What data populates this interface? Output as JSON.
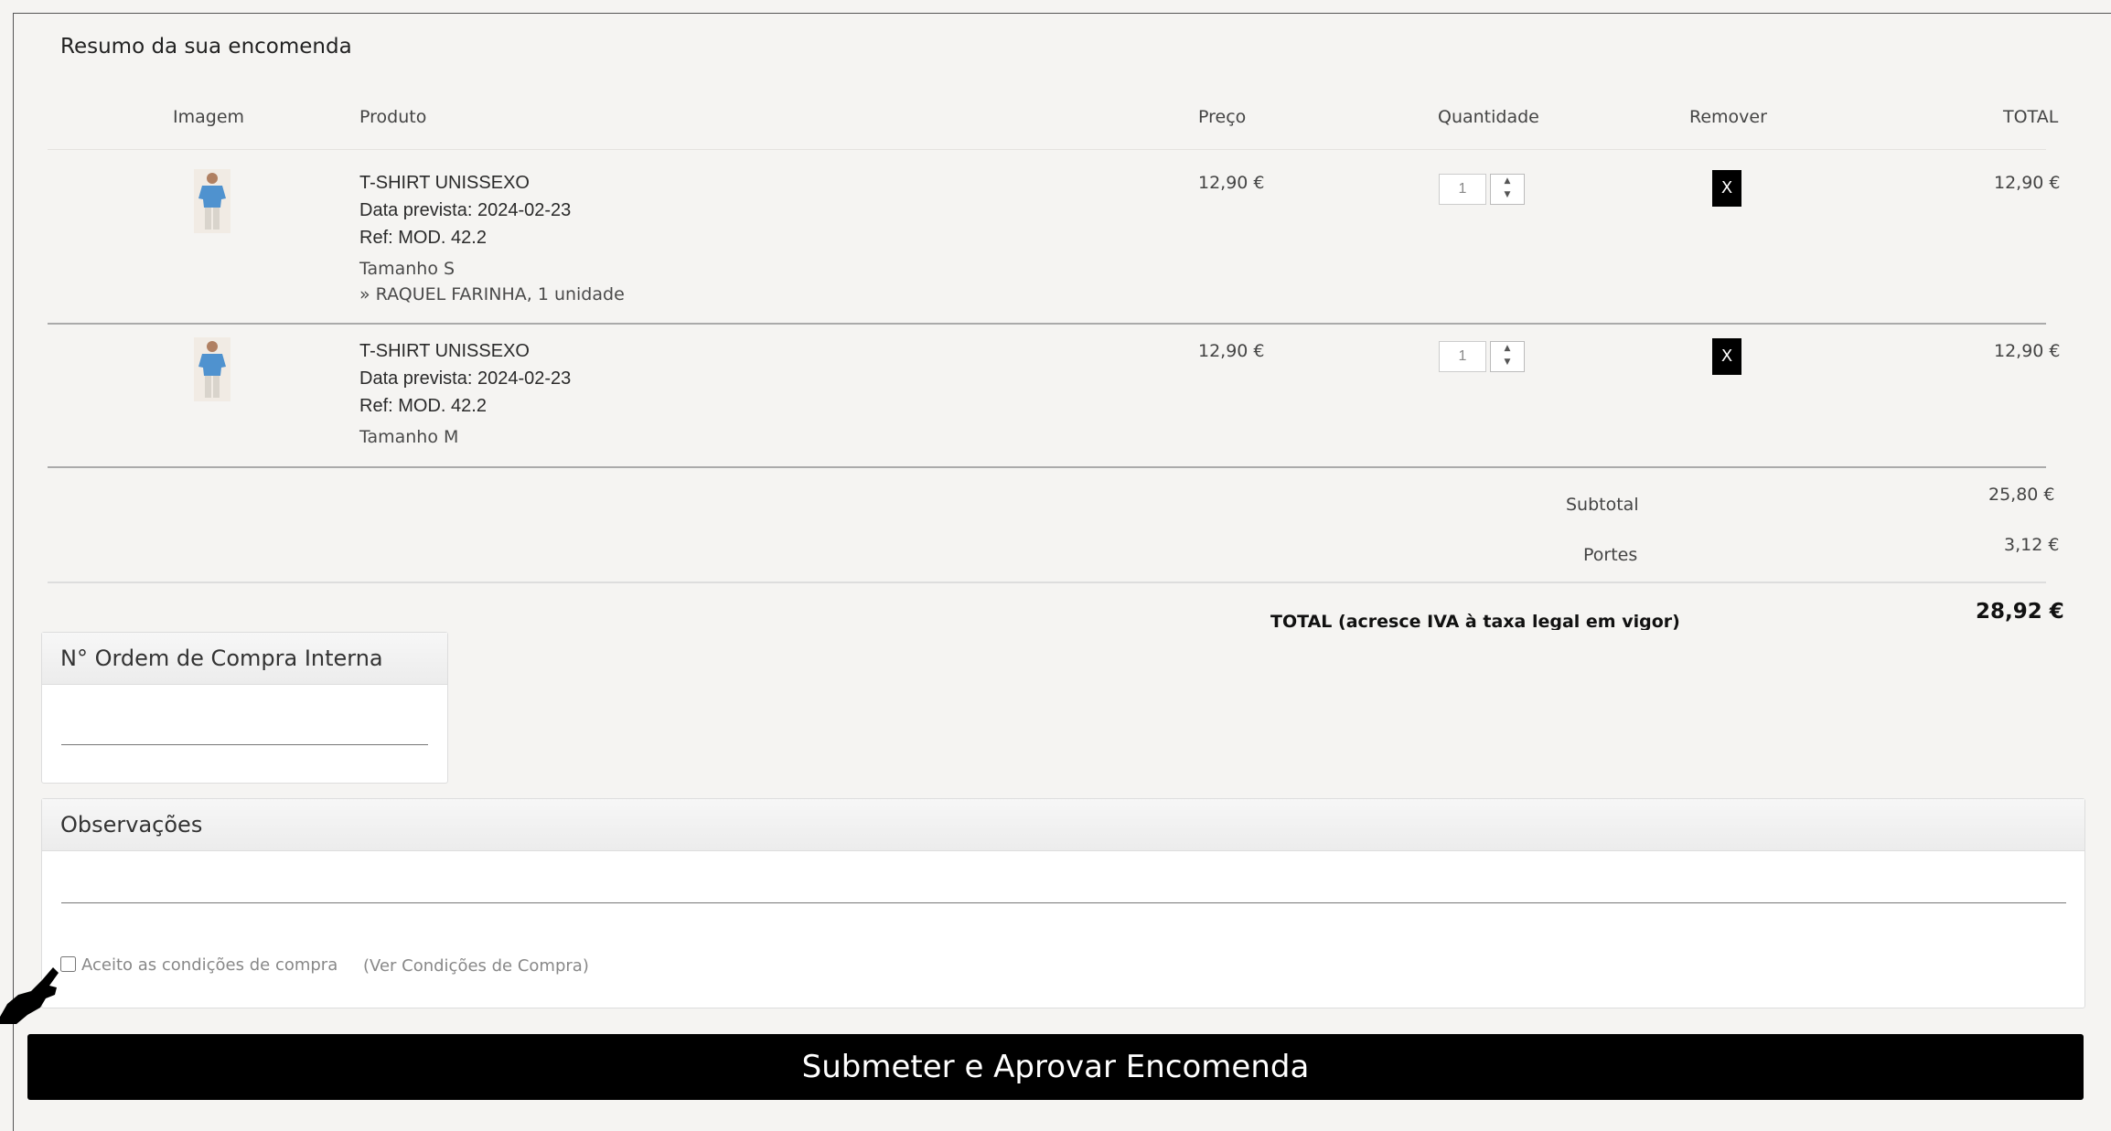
{
  "order": {
    "title": "Resumo da sua encomenda",
    "columns": {
      "image": "Imagem",
      "product": "Produto",
      "price": "Preço",
      "quantity": "Quantidade",
      "remove": "Remover",
      "total": "TOTAL"
    },
    "items": [
      {
        "name": "T-SHIRT UNISSEXO",
        "date": "Data prevista: 2024-02-23",
        "ref": "Ref: MOD. 42.2",
        "size": "Tamanho S",
        "extra": "» RAQUEL FARINHA, 1 unidade",
        "price": "12,90 €",
        "quantity": "1",
        "remove_label": "X",
        "total": "12,90 €"
      },
      {
        "name": "T-SHIRT UNISSEXO",
        "date": "Data prevista: 2024-02-23",
        "ref": "Ref: MOD. 42.2",
        "size": "Tamanho M",
        "price": "12,90 €",
        "quantity": "1",
        "remove_label": "X",
        "total": "12,90 €"
      }
    ],
    "subtotal_label": "Subtotal",
    "subtotal_value": "25,80 €",
    "shipping_label": "Portes",
    "shipping_value": "3,12 €",
    "grand_total_label": "TOTAL (acresce IVA à taxa legal em vigor)",
    "grand_total_value": "28,92 €"
  },
  "purchase_order": {
    "title": "N° Ordem de Compra Interna",
    "value": ""
  },
  "notes": {
    "title": "Observações",
    "value": "",
    "accept_label": "Aceito as condições de compra",
    "conditions_link": "(Ver Condições de Compra)",
    "accepted": false
  },
  "submit_label": "Submeter e Aprovar Encomenda",
  "icons": {
    "spinner_up": "▲",
    "spinner_down": "▼",
    "cursor": "hand-pointer-icon"
  }
}
